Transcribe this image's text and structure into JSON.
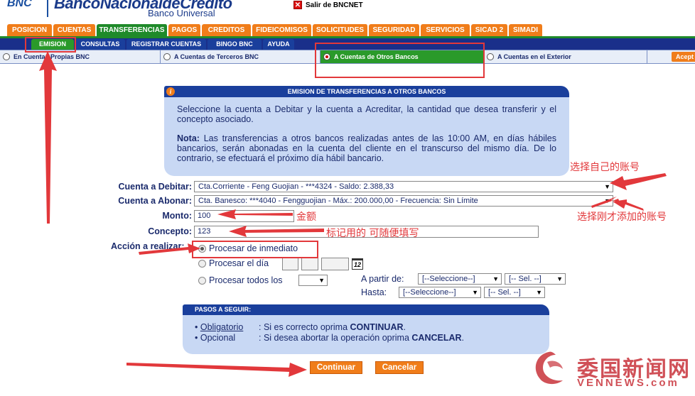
{
  "header": {
    "logo_short": "BNC",
    "logo_name": "BancoNacionaldeCredito",
    "logo_sub": "Banco Universal",
    "logout_label": "Salir de BNCNET"
  },
  "main_menu": [
    "POSICION",
    "CUENTAS",
    "TRANSFERENCIAS",
    "PAGOS",
    "CREDITOS",
    "FIDEICOMISOS",
    "SOLICITUDES",
    "SEGURIDAD",
    "SERVICIOS",
    "SICAD 2",
    "SIMADI"
  ],
  "main_menu_active": "TRANSFERENCIAS",
  "sub_menu": [
    "EMISION",
    "CONSULTAS",
    "REGISTRAR CUENTAS",
    "BINGO BNC",
    "AYUDA"
  ],
  "sub_menu_active": "EMISION",
  "options": [
    "En Cuentas Propias BNC",
    "A Cuentas de Terceros BNC",
    "A Cuentas de Otros Bancos",
    "A Cuentas en el Exterior"
  ],
  "options_active": "A Cuentas de Otros Bancos",
  "accept_label": "Acept",
  "info": {
    "title": "EMISION DE TRANSFERENCIAS A OTROS BANCOS",
    "text": "Seleccione la cuenta a Debitar y la cuenta a Acreditar, la cantidad que desea transferir y el concepto asociado.",
    "note_label": "Nota:",
    "note_text": "Las transferencias a otros bancos realizadas antes de las 10:00 AM, en días hábiles bancarios, serán abonadas en la cuenta del cliente en el transcurso del mismo día. De lo contrario, se efectuará el próximo día hábil bancario."
  },
  "form": {
    "debit_label": "Cuenta a Debitar:",
    "debit_value": "Cta.Corriente - Feng Guojian - ***4324 - Saldo: 2.388,33",
    "credit_label": "Cuenta a Abonar:",
    "credit_value": "Cta. Banesco: ***4040 - Fengguojian - Máx.: 200.000,00 - Frecuencia: Sin Límite",
    "amount_label": "Monto:",
    "amount_value": "100",
    "concept_label": "Concepto:",
    "concept_value": "123",
    "action_label": "Acción a realizar:",
    "action_now": "Procesar de inmediato",
    "action_day": "Procesar el día",
    "action_every": "Procesar todos los",
    "from_label": "A partir de:",
    "until_label": "Hasta:",
    "select_placeholder": "[--Seleccione--]",
    "sel_placeholder": "[-- Sel. --]",
    "cal_label": "12"
  },
  "steps": {
    "title": "PASOS A SEGUIR:",
    "rows": [
      {
        "key": "Obligatorio",
        "text": ": Si es correcto oprima ",
        "action": "CONTINUAR",
        "end": "."
      },
      {
        "key": "Opcional",
        "text": ": Si desea abortar la operación oprima ",
        "action": "CANCELAR",
        "end": "."
      }
    ]
  },
  "buttons": {
    "continue": "Continuar",
    "cancel": "Cancelar"
  },
  "annotations": {
    "choose_own_account": "选择自己的账号",
    "choose_added_account": "选择刚才添加的账号",
    "amount": "金额",
    "concept": "标记用的 可随便填写"
  },
  "watermark": {
    "cn": "委国新闻网",
    "en": "VENNEWS.com"
  },
  "colors": {
    "orange": "#f07d1a",
    "green": "#1f8a2a",
    "navy": "#1a3f9c",
    "light_blue": "#c8d8f4",
    "annotation_red": "#e2383b"
  }
}
